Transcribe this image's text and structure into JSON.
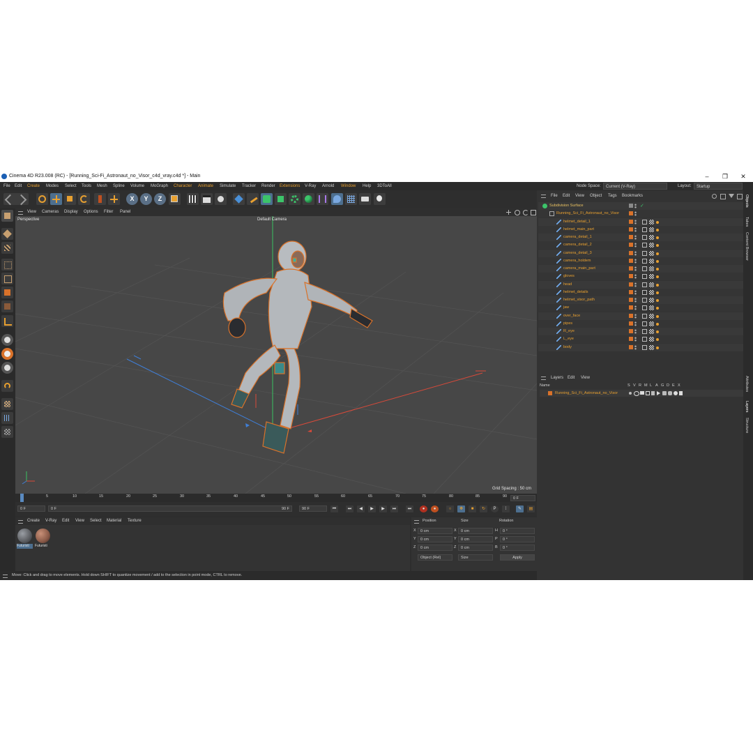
{
  "window": {
    "title": "Cinema 4D R23.008 (RC) - [Running_Sci-Fi_Astronaut_no_Visor_c4d_vray.c4d *] - Main",
    "controls": [
      "–",
      "❐",
      "✕"
    ]
  },
  "menubar": {
    "items": [
      "File",
      "Edit",
      "Create",
      "Modes",
      "Select",
      "Tools",
      "Mesh",
      "Spline",
      "Volume",
      "MoGraph",
      "Character",
      "Animate",
      "Simulate",
      "Tracker",
      "Render",
      "Extensions",
      "V-Ray",
      "Arnold",
      "Window",
      "Help",
      "3DToAll"
    ],
    "node_space_label": "Node Space:",
    "node_space_value": "Current (V-Ray)",
    "layout_label": "Layout:",
    "layout_value": "Startup"
  },
  "toolbar": {
    "axis_x": "X",
    "axis_y": "Y",
    "axis_z": "Z",
    "icons": [
      "undo-icon",
      "redo-icon",
      "live-select-icon",
      "move-icon",
      "scale-icon",
      "rotate-icon",
      "recent-tools-icon",
      "add-icon",
      "axis-x-icon",
      "axis-y-icon",
      "axis-z-icon",
      "coordinate-system-icon",
      "render-region-icon",
      "render-view-icon",
      "render-settings-icon",
      "cube-icon",
      "pen-icon",
      "subdivision-icon",
      "extrude-icon",
      "cloner-icon",
      "fracture-icon",
      "deformer-icon",
      "floor-icon",
      "camera-icon",
      "light-icon"
    ]
  },
  "viewport": {
    "menu": [
      "View",
      "Cameras",
      "Display",
      "Options",
      "Filter",
      "Panel"
    ],
    "label": "Perspective",
    "camera": "Default Camera",
    "grid_spacing": "Grid Spacing : 50 cm"
  },
  "timeline": {
    "ticks": [
      "0",
      "5",
      "10",
      "15",
      "20",
      "25",
      "30",
      "35",
      "40",
      "45",
      "50",
      "55",
      "60",
      "65",
      "70",
      "75",
      "80",
      "85",
      "90"
    ],
    "current_frame": "0 F"
  },
  "playbar": {
    "start": "0 F",
    "slider_start": "0 F",
    "slider_end": "90 F",
    "end": "90 F"
  },
  "materials": {
    "menu": [
      "Create",
      "V-Ray",
      "Edit",
      "View",
      "Select",
      "Material",
      "Texture"
    ],
    "items": [
      {
        "label": "Futuristi",
        "color": "#5a5c60"
      },
      {
        "label": "Futuristi",
        "color": "#8a5a48"
      }
    ]
  },
  "coordinates": {
    "headers": [
      "Position",
      "Size",
      "Rotation"
    ],
    "rows": [
      {
        "pos_axis": "X",
        "pos": "0 cm",
        "size_axis": "X",
        "size": "0 cm",
        "rot_axis": "H",
        "rot": "0 °"
      },
      {
        "pos_axis": "Y",
        "pos": "0 cm",
        "size_axis": "Y",
        "size": "0 cm",
        "rot_axis": "P",
        "rot": "0 °"
      },
      {
        "pos_axis": "Z",
        "pos": "0 cm",
        "size_axis": "Z",
        "size": "0 cm",
        "rot_axis": "B",
        "rot": "0 °"
      }
    ],
    "mode": "Object (Rel)",
    "size_mode": "Size",
    "apply": "Apply"
  },
  "status": {
    "text": "Move: Click and drag to move elements. Hold down SHIFT to quantize movement / add to the selection in point mode, CTRL to remove."
  },
  "objects": {
    "menu": [
      "File",
      "Edit",
      "View",
      "Object",
      "Tags",
      "Bookmarks"
    ],
    "items": [
      {
        "name": "Subdivision Surface",
        "level": 0
      },
      {
        "name": "Running_Sci_Fi_Astronaut_no_Visor",
        "level": 1
      },
      {
        "name": "helmet_detail_1",
        "level": 2
      },
      {
        "name": "helmet_main_part",
        "level": 2
      },
      {
        "name": "camera_detail_1",
        "level": 2
      },
      {
        "name": "camera_detail_2",
        "level": 2
      },
      {
        "name": "camera_detail_3",
        "level": 2
      },
      {
        "name": "camera_holdem",
        "level": 2
      },
      {
        "name": "camera_main_part",
        "level": 2
      },
      {
        "name": "gloves",
        "level": 2
      },
      {
        "name": "head",
        "level": 2
      },
      {
        "name": "helmet_details",
        "level": 2
      },
      {
        "name": "helmet_visor_path",
        "level": 2
      },
      {
        "name": "jaw",
        "level": 2
      },
      {
        "name": "over_face",
        "level": 2
      },
      {
        "name": "pipes",
        "level": 2
      },
      {
        "name": "R_eye",
        "level": 2
      },
      {
        "name": "L_eye",
        "level": 2
      },
      {
        "name": "body",
        "level": 2
      }
    ]
  },
  "layers": {
    "menu": [
      "Layers",
      "Edit",
      "View"
    ],
    "header_name": "Name",
    "header_flags": [
      "S",
      "V",
      "R",
      "M",
      "L",
      "A",
      "G",
      "D",
      "E",
      "X"
    ],
    "items": [
      {
        "name": "Running_Sci_Fi_Astronaut_no_Visor",
        "color": "#d9722a"
      }
    ]
  },
  "side_tabs": [
    "Objects",
    "Takes",
    "Content Browser",
    "Attributes",
    "Layers",
    "Structure"
  ],
  "colors": {
    "accent_orange": "#e8a030",
    "object_orange": "#d9722a",
    "highlight_blue": "#4d6f8f",
    "viewport_bg": "#474747",
    "panel_bg": "#333333"
  }
}
